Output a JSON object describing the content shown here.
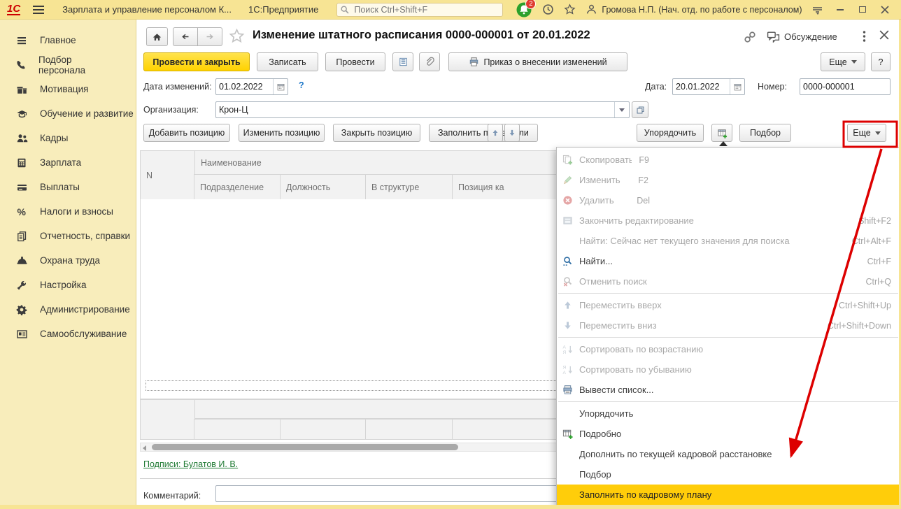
{
  "topbar": {
    "logo": "1С",
    "app_title": "Зарплата и управление персоналом К...",
    "platform_title": "1С:Предприятие",
    "search_placeholder": "Поиск Ctrl+Shift+F",
    "notification_count": "2",
    "user_name": "Громова Н.П. (Нач. отд. по работе с персоналом)"
  },
  "sidebar": {
    "items": [
      {
        "label": "Главное",
        "icon": "menu"
      },
      {
        "label": "Подбор персонала",
        "icon": "phone"
      },
      {
        "label": "Мотивация",
        "icon": "gift"
      },
      {
        "label": "Обучение и развитие",
        "icon": "graduation"
      },
      {
        "label": "Кадры",
        "icon": "people"
      },
      {
        "label": "Зарплата",
        "icon": "calculator"
      },
      {
        "label": "Выплаты",
        "icon": "card"
      },
      {
        "label": "Налоги и взносы",
        "icon": "percent"
      },
      {
        "label": "Отчетность, справки",
        "icon": "reports"
      },
      {
        "label": "Охрана труда",
        "icon": "helmet"
      },
      {
        "label": "Настройка",
        "icon": "wrench"
      },
      {
        "label": "Администрирование",
        "icon": "gear"
      },
      {
        "label": "Самообслуживание",
        "icon": "badge"
      }
    ]
  },
  "doc": {
    "title": "Изменение штатного расписания 0000-000001 от 20.01.2022",
    "discussion": "Обсуждение",
    "btn_post_close": "Провести и закрыть",
    "btn_save": "Записать",
    "btn_post": "Провести",
    "btn_order_print": "Приказ о внесении изменений",
    "btn_more": "Еще",
    "btn_help": "?",
    "lbl_change_date": "Дата изменений:",
    "val_change_date": "01.02.2022",
    "field_help": "?",
    "lbl_date": "Дата:",
    "val_date": "20.01.2022",
    "lbl_number": "Номер:",
    "val_number": "0000-000001",
    "lbl_org": "Организация:",
    "val_org": "Крон-Ц",
    "cmd_buttons": [
      "Добавить позицию",
      "Изменить позицию",
      "Закрыть позицию",
      "Заполнить показатели"
    ],
    "cmd_order": "Упорядочить",
    "cmd_pick": "Подбор",
    "cmd_more": "Еще",
    "table": {
      "col_n": "N",
      "col_name": "Наименование",
      "subcols": [
        "Подразделение",
        "Должность",
        "В структуре",
        "Позиция ка"
      ]
    },
    "signatures_link": "Подписи: Булатов И. В.",
    "lbl_comment": "Комментарий:",
    "comment_value": ""
  },
  "menu": {
    "items": [
      {
        "label": "Скопировать",
        "shortcut": "F9",
        "icon": "copy",
        "disabled": true
      },
      {
        "label": "Изменить",
        "shortcut": "F2",
        "icon": "pencil",
        "disabled": true
      },
      {
        "label": "Удалить",
        "shortcut": "Del",
        "icon": "delete",
        "disabled": true
      },
      {
        "label": "Закончить редактирование",
        "shortcut": "Shift+F2",
        "icon": "finish-edit",
        "disabled": true
      },
      {
        "label": "Найти: Сейчас нет текущего значения для поиска",
        "shortcut": "Ctrl+Alt+F",
        "icon": "",
        "disabled": true
      },
      {
        "label": "Найти...",
        "shortcut": "Ctrl+F",
        "icon": "find",
        "disabled": false
      },
      {
        "label": "Отменить поиск",
        "shortcut": "Ctrl+Q",
        "icon": "cancel-find",
        "disabled": true
      },
      {
        "separator": true
      },
      {
        "label": "Переместить вверх",
        "shortcut": "Ctrl+Shift+Up",
        "icon": "move-up",
        "disabled": true
      },
      {
        "label": "Переместить вниз",
        "shortcut": "Ctrl+Shift+Down",
        "icon": "move-down",
        "disabled": true
      },
      {
        "separator": true
      },
      {
        "label": "Сортировать по возрастанию",
        "shortcut": "",
        "icon": "sort-asc",
        "disabled": true
      },
      {
        "label": "Сортировать по убыванию",
        "shortcut": "",
        "icon": "sort-desc",
        "disabled": true
      },
      {
        "label": "Вывести список...",
        "shortcut": "",
        "icon": "print-list",
        "disabled": false
      },
      {
        "separator": true
      },
      {
        "label": "Упорядочить",
        "shortcut": "",
        "icon": "",
        "disabled": false
      },
      {
        "label": "Подробно",
        "shortcut": "",
        "icon": "detail",
        "disabled": false
      },
      {
        "label": "Дополнить по текущей кадровой расстановке",
        "shortcut": "",
        "icon": "",
        "disabled": false
      },
      {
        "label": "Подбор",
        "shortcut": "",
        "icon": "",
        "disabled": false
      },
      {
        "label": "Заполнить по кадровому плану",
        "shortcut": "",
        "icon": "",
        "disabled": false,
        "highlighted": true
      }
    ]
  },
  "annotation": {
    "color": "#dd0000"
  }
}
